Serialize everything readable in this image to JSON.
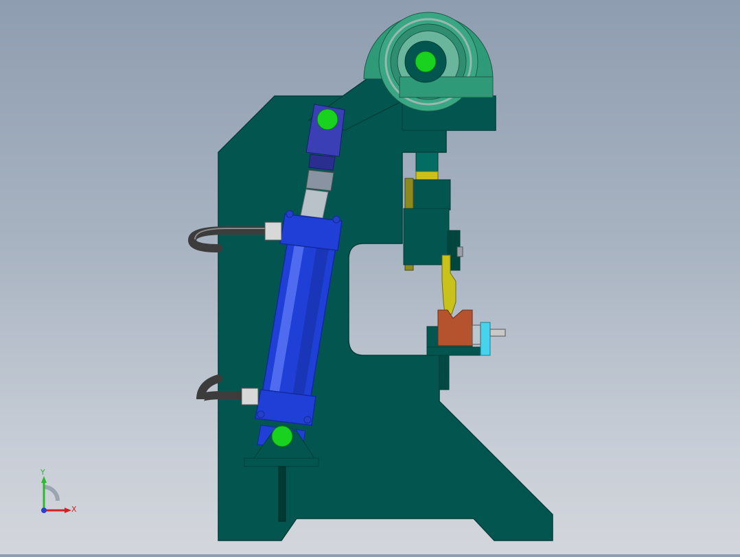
{
  "triad": {
    "x_label": "X",
    "y_label": "Y"
  },
  "colors": {
    "frame": "#02564f",
    "frame_dark": "#013f3a",
    "cylinder": "#1f3fd6",
    "cylinder_dark": "#122a9e",
    "pin": "#19d11f",
    "hose": "#4a4a4a",
    "rod": "#b9c2c9",
    "bearing": "#2f9a78",
    "workpiece": "#b5532f",
    "clamp": "#46d3ee",
    "guide": "#8a8a1f",
    "punch": "#c8c21a"
  }
}
